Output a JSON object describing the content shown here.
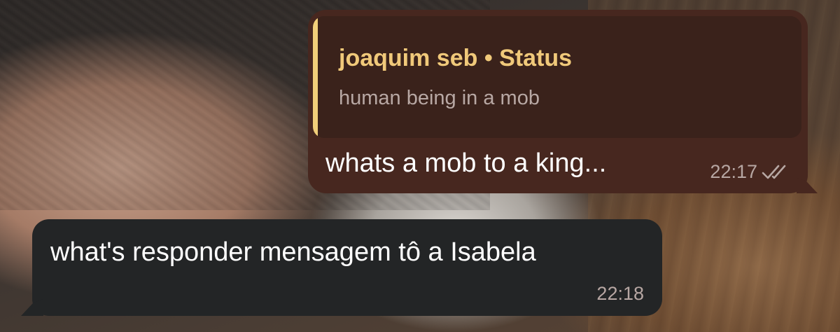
{
  "messages": {
    "outgoing": {
      "quote": {
        "author": "joaquim seb • Status",
        "text": "human being in a mob",
        "accent_color": "#f2cf7a"
      },
      "text": "whats a mob to a king...",
      "time": "22:17",
      "status_icon": "double-check-icon",
      "bubble_color": "#47271f"
    },
    "incoming": {
      "text": "what's responder mensagem tô a Isabela",
      "time": "22:18",
      "bubble_color": "#232526"
    }
  }
}
